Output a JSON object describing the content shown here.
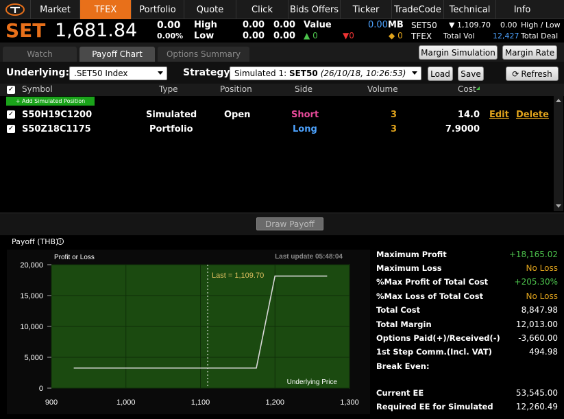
{
  "nav": {
    "tabs": [
      "Market",
      "TFEX",
      "Portfolio",
      "Quote",
      "Click",
      "Bids Offers",
      "Ticker",
      "TradeCode",
      "Technical",
      "Info"
    ],
    "active": "TFEX"
  },
  "ticker": {
    "index_name": "SET",
    "index_value": "1,681.84",
    "change": "0.00",
    "change_pct": "0.00%",
    "high_label": "High",
    "low_label": "Low",
    "high1": "0.00",
    "high2": "0.00",
    "low1": "0.00",
    "low2": "0.00",
    "value_label": "Value",
    "value": "0.00",
    "value_unit": "MB",
    "up_count": "0",
    "down_count": "0",
    "unch_count": "0",
    "set50_label": "SET50",
    "set50_value": "1,109.70",
    "set50_change": "0.00",
    "high_low_label": "High / Low",
    "tfex_label": "TFEX",
    "total_vol_label": "Total Vol",
    "total_vol": "12,427",
    "total_deal_label": "Total Deal"
  },
  "subtabs": [
    "Watch",
    "Payoff Chart",
    "Options Summary"
  ],
  "subtab_active": "Payoff Chart",
  "actions": {
    "margin_sim": "Margin Simulation",
    "margin_rate": "Margin Rate"
  },
  "controls": {
    "underlying_label": "Underlying:",
    "underlying_value": ".SET50 Index",
    "strategy_label": "Strategy:",
    "strategy_prefix": "Simulated 1: ",
    "strategy_name": "SET50",
    "strategy_time": "(26/10/18, 10:26:53)",
    "load": "Load",
    "save": "Save",
    "refresh": "Refresh"
  },
  "grid": {
    "headers": [
      "Symbol",
      "Type",
      "Position",
      "Side",
      "Volume",
      "Cost"
    ],
    "add_label": "+ Add Simulated Position",
    "rows": [
      {
        "symbol": "S50H19C1200",
        "type": "Simulated",
        "position": "Open",
        "side": "Short",
        "volume": "3",
        "cost": "14.0",
        "edit": "Edit",
        "delete": "Delete"
      },
      {
        "symbol": "S50Z18C1175",
        "type": "Portfolio",
        "position": "",
        "side": "Long",
        "volume": "3",
        "cost": "7.9000"
      }
    ],
    "draw_payoff": "Draw Payoff"
  },
  "payoff": {
    "title": "Payoff (THB)",
    "info_icon": "info-icon"
  },
  "chart_data": {
    "type": "line",
    "ylabel": "Profit or Loss",
    "xlabel": "Underlying Price",
    "last_update": "Last update 05:48:04",
    "annotation": "Last = 1,109.70",
    "annotation_x": 1109.7,
    "xlim": [
      900,
      1300
    ],
    "ylim": [
      0,
      20000
    ],
    "xticks": [
      "900",
      "1,000",
      "1,100",
      "1,200",
      "1,300"
    ],
    "yticks": [
      "0",
      "5,000",
      "10,000",
      "15,000",
      "20,000"
    ],
    "series": [
      {
        "x": [
          930,
          1175,
          1200,
          1270
        ],
        "y": [
          3260,
          3260,
          18165,
          18165
        ]
      }
    ],
    "grid": true
  },
  "stats": [
    {
      "label": "Maximum Profit",
      "value": "+18,165.02",
      "color": "green"
    },
    {
      "label": "Maximum Loss",
      "value": "No Loss",
      "color": "yellow"
    },
    {
      "label": "%Max Profit of Total Cost",
      "value": "+205.30%",
      "color": "green"
    },
    {
      "label": "%Max Loss of Total Cost",
      "value": "No Loss",
      "color": "yellow"
    },
    {
      "label": "Total Cost",
      "value": "8,847.98",
      "color": "white"
    },
    {
      "label": "Total Margin",
      "value": "12,013.00",
      "color": "white"
    },
    {
      "label": "Options Paid(+)/Received(-)",
      "value": "-3,660.00",
      "color": "white"
    },
    {
      "label": "1st Step Comm.(Incl. VAT)",
      "value": "494.98",
      "color": "white"
    },
    {
      "label": "Break Even:",
      "value": "",
      "color": "white"
    },
    {
      "label": "Current EE",
      "value": "53,545.00",
      "color": "white"
    },
    {
      "label": "Required EE for Simulated",
      "value": "12,260.49",
      "color": "white"
    }
  ]
}
